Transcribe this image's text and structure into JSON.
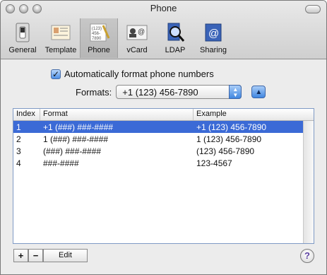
{
  "window": {
    "title": "Phone"
  },
  "toolbar": {
    "items": [
      {
        "label": "General",
        "icon": "general-switch-icon"
      },
      {
        "label": "Template",
        "icon": "template-card-icon"
      },
      {
        "label": "Phone",
        "icon": "phone-pad-icon",
        "selected": true
      },
      {
        "label": "vCard",
        "icon": "vcard-icon"
      },
      {
        "label": "LDAP",
        "icon": "ldap-magnifier-icon"
      },
      {
        "label": "Sharing",
        "icon": "sharing-at-icon"
      }
    ]
  },
  "settings": {
    "auto_format_label": "Automatically format phone numbers",
    "auto_format_checked": true,
    "formats_label": "Formats:",
    "formats_selected": "+1 (123) 456-7890"
  },
  "table": {
    "columns": [
      "Index",
      "Format",
      "Example"
    ],
    "rows": [
      {
        "index": "1",
        "format": "+1 (###) ###-####",
        "example": "+1 (123) 456-7890",
        "selected": true
      },
      {
        "index": "2",
        "format": "1 (###) ###-####",
        "example": "1 (123) 456-7890"
      },
      {
        "index": "3",
        "format": "(###) ###-####",
        "example": "(123) 456-7890"
      },
      {
        "index": "4",
        "format": "###-####",
        "example": "123-4567"
      }
    ]
  },
  "buttons": {
    "add": "+",
    "remove": "−",
    "edit": "Edit",
    "help": "?"
  },
  "colors": {
    "selection": "#3b6ad6",
    "aqua_blue": "#3f86e0"
  }
}
